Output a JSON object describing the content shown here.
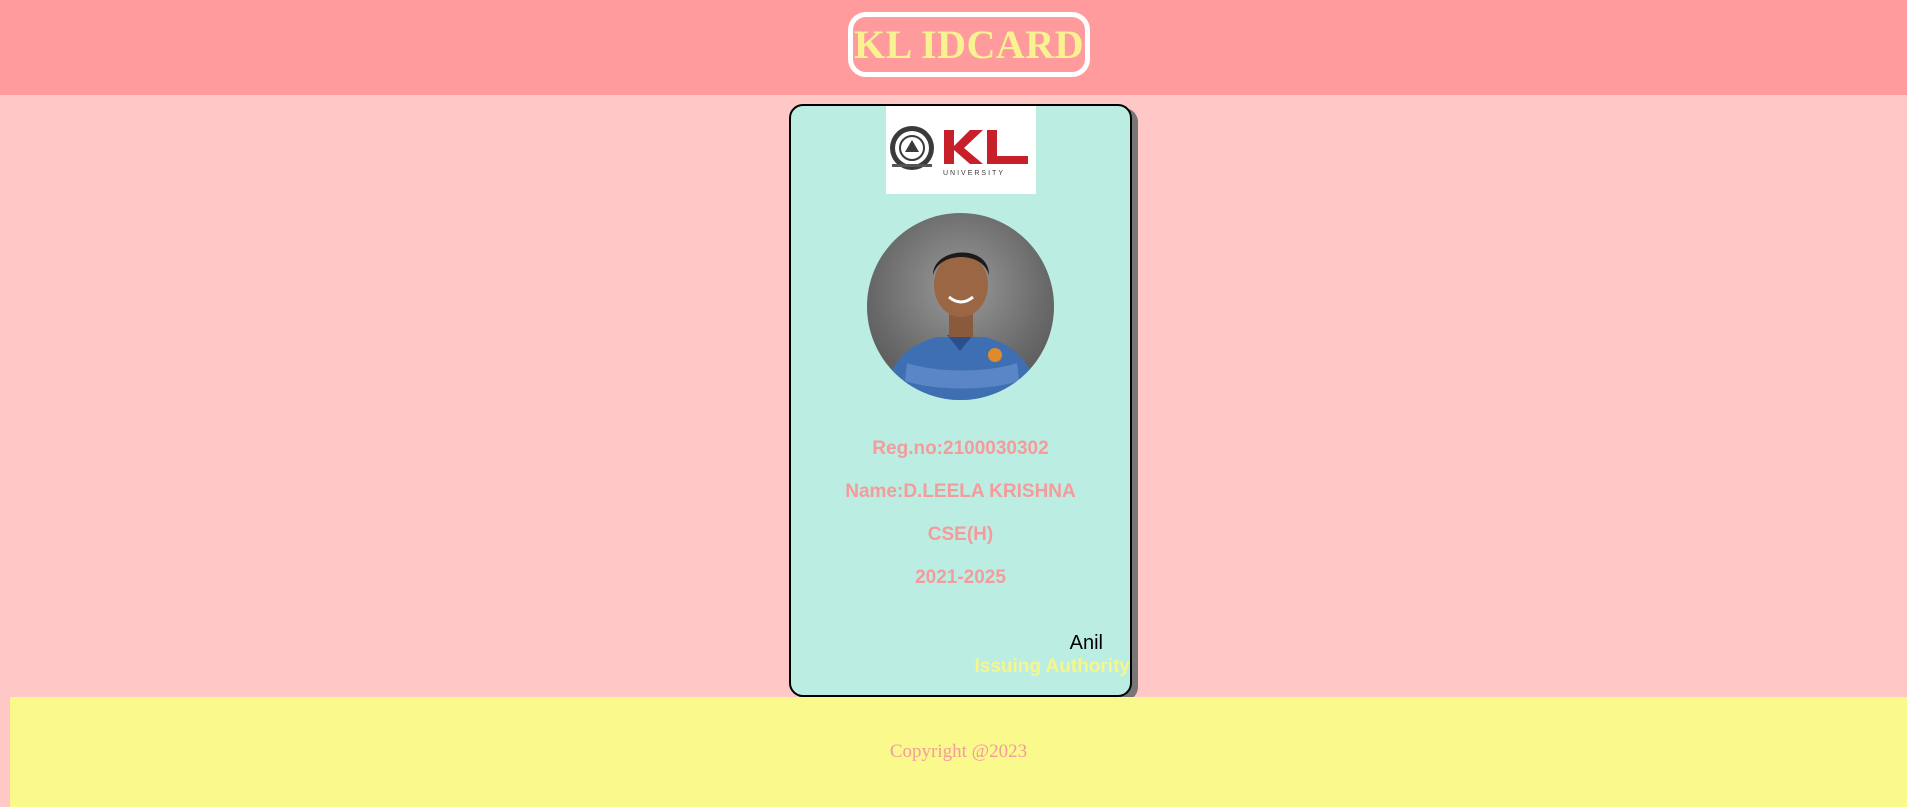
{
  "header": {
    "title": "KL IDCARD"
  },
  "card": {
    "logo_text": "KL",
    "logo_subtext": "UNIVERSITY",
    "reg_no": "Reg.no:2100030302",
    "name": "Name:D.LEELA KRISHNA",
    "branch": "CSE(H)",
    "batch": "2021-2025",
    "signature": "Anil",
    "signature_label": "Issuing Authority"
  },
  "footer": {
    "copyright": "Copyright @2023"
  },
  "colors": {
    "page_bg": "#ffc8c6",
    "header_bg": "#ff9b9d",
    "title_color": "#f9f290",
    "card_bg": "#bbede2",
    "info_text": "#f59b9c",
    "authority_text": "#f7f68a",
    "footer_bg": "#f9f98c",
    "logo_red": "#c8202b"
  }
}
